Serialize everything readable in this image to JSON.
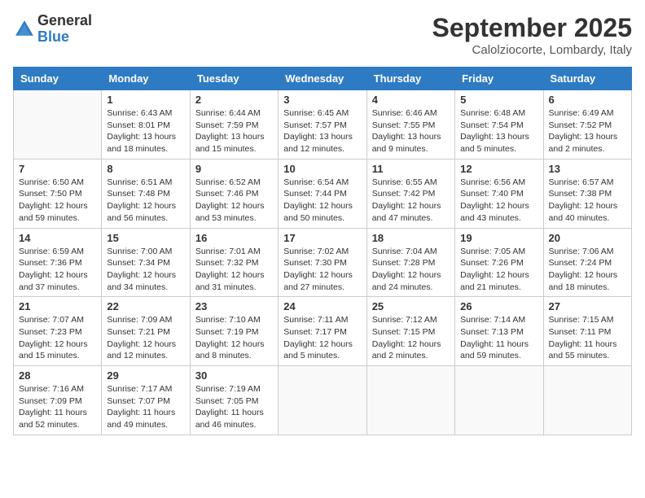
{
  "header": {
    "logo_general": "General",
    "logo_blue": "Blue",
    "month_title": "September 2025",
    "subtitle": "Calolziocorte, Lombardy, Italy"
  },
  "weekdays": [
    "Sunday",
    "Monday",
    "Tuesday",
    "Wednesday",
    "Thursday",
    "Friday",
    "Saturday"
  ],
  "weeks": [
    [
      {
        "day": "",
        "info": ""
      },
      {
        "day": "1",
        "info": "Sunrise: 6:43 AM\nSunset: 8:01 PM\nDaylight: 13 hours\nand 18 minutes."
      },
      {
        "day": "2",
        "info": "Sunrise: 6:44 AM\nSunset: 7:59 PM\nDaylight: 13 hours\nand 15 minutes."
      },
      {
        "day": "3",
        "info": "Sunrise: 6:45 AM\nSunset: 7:57 PM\nDaylight: 13 hours\nand 12 minutes."
      },
      {
        "day": "4",
        "info": "Sunrise: 6:46 AM\nSunset: 7:55 PM\nDaylight: 13 hours\nand 9 minutes."
      },
      {
        "day": "5",
        "info": "Sunrise: 6:48 AM\nSunset: 7:54 PM\nDaylight: 13 hours\nand 5 minutes."
      },
      {
        "day": "6",
        "info": "Sunrise: 6:49 AM\nSunset: 7:52 PM\nDaylight: 13 hours\nand 2 minutes."
      }
    ],
    [
      {
        "day": "7",
        "info": "Sunrise: 6:50 AM\nSunset: 7:50 PM\nDaylight: 12 hours\nand 59 minutes."
      },
      {
        "day": "8",
        "info": "Sunrise: 6:51 AM\nSunset: 7:48 PM\nDaylight: 12 hours\nand 56 minutes."
      },
      {
        "day": "9",
        "info": "Sunrise: 6:52 AM\nSunset: 7:46 PM\nDaylight: 12 hours\nand 53 minutes."
      },
      {
        "day": "10",
        "info": "Sunrise: 6:54 AM\nSunset: 7:44 PM\nDaylight: 12 hours\nand 50 minutes."
      },
      {
        "day": "11",
        "info": "Sunrise: 6:55 AM\nSunset: 7:42 PM\nDaylight: 12 hours\nand 47 minutes."
      },
      {
        "day": "12",
        "info": "Sunrise: 6:56 AM\nSunset: 7:40 PM\nDaylight: 12 hours\nand 43 minutes."
      },
      {
        "day": "13",
        "info": "Sunrise: 6:57 AM\nSunset: 7:38 PM\nDaylight: 12 hours\nand 40 minutes."
      }
    ],
    [
      {
        "day": "14",
        "info": "Sunrise: 6:59 AM\nSunset: 7:36 PM\nDaylight: 12 hours\nand 37 minutes."
      },
      {
        "day": "15",
        "info": "Sunrise: 7:00 AM\nSunset: 7:34 PM\nDaylight: 12 hours\nand 34 minutes."
      },
      {
        "day": "16",
        "info": "Sunrise: 7:01 AM\nSunset: 7:32 PM\nDaylight: 12 hours\nand 31 minutes."
      },
      {
        "day": "17",
        "info": "Sunrise: 7:02 AM\nSunset: 7:30 PM\nDaylight: 12 hours\nand 27 minutes."
      },
      {
        "day": "18",
        "info": "Sunrise: 7:04 AM\nSunset: 7:28 PM\nDaylight: 12 hours\nand 24 minutes."
      },
      {
        "day": "19",
        "info": "Sunrise: 7:05 AM\nSunset: 7:26 PM\nDaylight: 12 hours\nand 21 minutes."
      },
      {
        "day": "20",
        "info": "Sunrise: 7:06 AM\nSunset: 7:24 PM\nDaylight: 12 hours\nand 18 minutes."
      }
    ],
    [
      {
        "day": "21",
        "info": "Sunrise: 7:07 AM\nSunset: 7:23 PM\nDaylight: 12 hours\nand 15 minutes."
      },
      {
        "day": "22",
        "info": "Sunrise: 7:09 AM\nSunset: 7:21 PM\nDaylight: 12 hours\nand 12 minutes."
      },
      {
        "day": "23",
        "info": "Sunrise: 7:10 AM\nSunset: 7:19 PM\nDaylight: 12 hours\nand 8 minutes."
      },
      {
        "day": "24",
        "info": "Sunrise: 7:11 AM\nSunset: 7:17 PM\nDaylight: 12 hours\nand 5 minutes."
      },
      {
        "day": "25",
        "info": "Sunrise: 7:12 AM\nSunset: 7:15 PM\nDaylight: 12 hours\nand 2 minutes."
      },
      {
        "day": "26",
        "info": "Sunrise: 7:14 AM\nSunset: 7:13 PM\nDaylight: 11 hours\nand 59 minutes."
      },
      {
        "day": "27",
        "info": "Sunrise: 7:15 AM\nSunset: 7:11 PM\nDaylight: 11 hours\nand 55 minutes."
      }
    ],
    [
      {
        "day": "28",
        "info": "Sunrise: 7:16 AM\nSunset: 7:09 PM\nDaylight: 11 hours\nand 52 minutes."
      },
      {
        "day": "29",
        "info": "Sunrise: 7:17 AM\nSunset: 7:07 PM\nDaylight: 11 hours\nand 49 minutes."
      },
      {
        "day": "30",
        "info": "Sunrise: 7:19 AM\nSunset: 7:05 PM\nDaylight: 11 hours\nand 46 minutes."
      },
      {
        "day": "",
        "info": ""
      },
      {
        "day": "",
        "info": ""
      },
      {
        "day": "",
        "info": ""
      },
      {
        "day": "",
        "info": ""
      }
    ]
  ]
}
